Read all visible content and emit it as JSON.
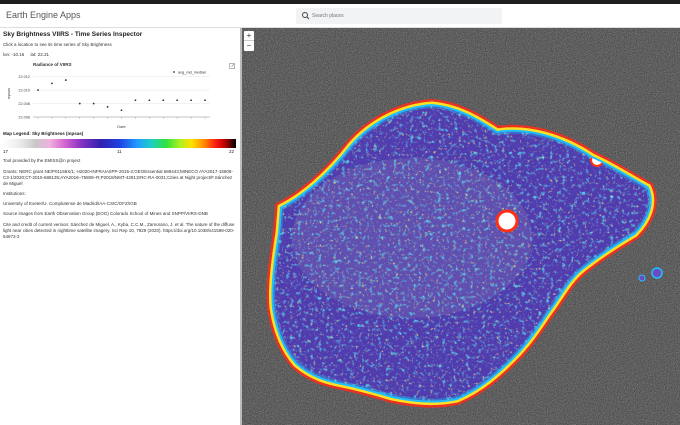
{
  "app": {
    "title": "Earth Engine Apps"
  },
  "search": {
    "placeholder": "Search places"
  },
  "panel": {
    "title": "Sky Brightness VIIRS - Time Series Inspector",
    "subtitle": "Click a location to see its time series of Sky Brightness",
    "lon": "lon: -10.16",
    "lat": "lat: 22.31"
  },
  "chart_data": {
    "type": "scatter",
    "title": "Radiance of VIIRS",
    "xlabel": "Date",
    "ylabel": "mpsas",
    "ylim": [
      22.006,
      22.013
    ],
    "y_ticks": [
      "22.012",
      "22.010",
      "22.008",
      "22.006"
    ],
    "series": [
      {
        "name": "avg_rad_median",
        "values": [
          22.01,
          22.011,
          22.0115,
          22.008,
          22.008,
          22.0075,
          22.007,
          22.0085,
          22.0085,
          22.0085,
          22.0085,
          22.0085,
          22.0085
        ]
      }
    ]
  },
  "legend": {
    "title": "Map Legend: Sky Brightness (mpsas)",
    "min": "17",
    "mid": "11",
    "max": "22"
  },
  "credits": {
    "tool": "Tool provided by the EMISS@n project",
    "grants": "Grants: NERC grant NE/P01156X/1; H2020-INFRAIA/IPP-2015-2;GEOEssential 689443;MINECO AYA2017-15808-C3-1/2020;CT-2015-688135;AYA2016–75808–R;P2018/NMT-4291;ERC-RA-0031;Cities at Night project/F.Sánchez de Miguel",
    "institutions": "Institutions:",
    "institutions_list": "University of Exeter/U. Complutense de Madrid/IAA-CSIC/GFZ/IGB",
    "source": "Source images from Earth Observation Group (EOG) Colorado School of Mines and SNPP/VIIRS-DNB",
    "cite": "Cite and credit of current version: Sánchez de Miguel, A., Kyba, C.C.M., Zamorano, J. et al. The nature of the diffuse light near cities detected in nighttime satellite imagery. Sci Rep 10, 7829 (2020). https://doi.org/10.1038/s41598-020-64673-2"
  },
  "map": {
    "zoom_in": "+",
    "zoom_out": "−"
  }
}
